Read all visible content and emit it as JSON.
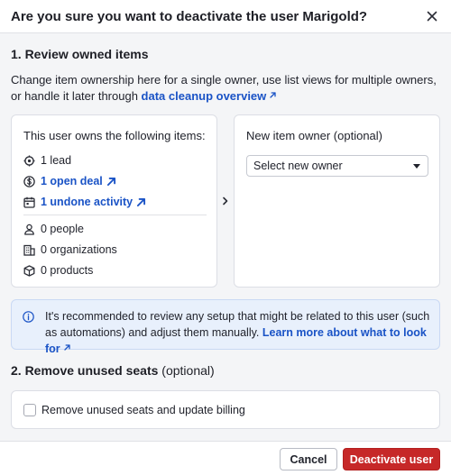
{
  "dialog": {
    "title": "Are you sure you want to deactivate the user Marigold?",
    "close_icon": "close-icon"
  },
  "section1": {
    "title": "1. Review owned items",
    "intro": "Change item ownership here for a single owner, use list views for multiple owners, or handle it later through ",
    "intro_link": "data cleanup overview"
  },
  "owned_items": {
    "heading": "This user owns the following items:",
    "transferable": [
      {
        "icon": "target-icon",
        "label": "1 lead",
        "link": false
      },
      {
        "icon": "dollar-icon",
        "label": "1 open deal",
        "link": true
      },
      {
        "icon": "calendar-icon",
        "label": "1 undone activity",
        "link": true
      }
    ],
    "non_transferable": [
      {
        "icon": "person-icon",
        "label": "0 people"
      },
      {
        "icon": "building-icon",
        "label": "0 organizations"
      },
      {
        "icon": "box-icon",
        "label": "0 products"
      }
    ]
  },
  "new_owner": {
    "heading": "New item owner (optional)",
    "select_placeholder": "Select new owner"
  },
  "info_banner": {
    "text": "It's recommended to review any setup that might be related to this user (such as automations) and adjust them manually. ",
    "link": "Learn more about what to look for"
  },
  "section2": {
    "title": "2. Remove unused seats",
    "title_suffix": " (optional)",
    "checkbox_label": "Remove unused seats and update billing",
    "checked": false
  },
  "footer": {
    "cancel_label": "Cancel",
    "deactivate_label": "Deactivate user"
  },
  "colors": {
    "link": "#1a53c6",
    "danger": "#c62828",
    "info_bg": "#e8f0fc",
    "body_bg": "#f4f5f7"
  }
}
